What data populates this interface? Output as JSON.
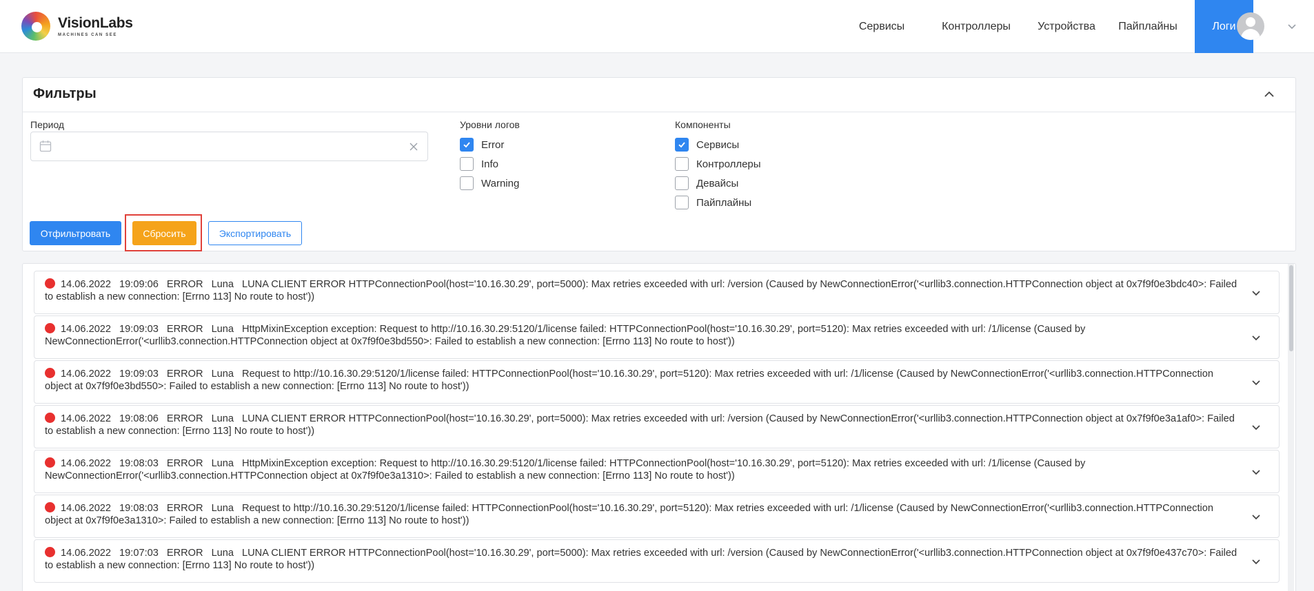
{
  "brand": {
    "name": "VisionLabs",
    "tagline": "MACHINES CAN SEE"
  },
  "nav": [
    {
      "label": "Сервисы",
      "active": false
    },
    {
      "label": "Контроллеры",
      "active": false
    },
    {
      "label": "Устройства",
      "active": false
    },
    {
      "label": "Пайплайны",
      "active": false
    },
    {
      "label": "Логи",
      "active": true
    }
  ],
  "filters": {
    "title": "Фильтры",
    "period_label": "Период",
    "period_value": "",
    "levels_label": "Уровни логов",
    "levels": [
      {
        "label": "Error",
        "checked": true
      },
      {
        "label": "Info",
        "checked": false
      },
      {
        "label": "Warning",
        "checked": false
      }
    ],
    "components_label": "Компоненты",
    "components": [
      {
        "label": "Сервисы",
        "checked": true
      },
      {
        "label": "Контроллеры",
        "checked": false
      },
      {
        "label": "Девайсы",
        "checked": false
      },
      {
        "label": "Пайплайны",
        "checked": false
      }
    ],
    "filter_button": "Отфильтровать",
    "reset_button": "Сбросить",
    "export_button": "Экспортировать"
  },
  "logs": [
    {
      "date": "14.06.2022",
      "time": "19:09:06",
      "level": "ERROR",
      "source": "Luna",
      "message": "LUNA CLIENT ERROR HTTPConnectionPool(host='10.16.30.29', port=5000): Max retries exceeded with url: /version (Caused by NewConnectionError('<urllib3.connection.HTTPConnection object at 0x7f9f0e3bdc40>: Failed to establish a new connection: [Errno 113] No route to host'))"
    },
    {
      "date": "14.06.2022",
      "time": "19:09:03",
      "level": "ERROR",
      "source": "Luna",
      "message": "HttpMixinException exception: Request to http://10.16.30.29:5120/1/license failed: HTTPConnectionPool(host='10.16.30.29', port=5120): Max retries exceeded with url: /1/license (Caused by NewConnectionError('<urllib3.connection.HTTPConnection object at 0x7f9f0e3bd550>: Failed to establish a new connection: [Errno 113] No route to host'))"
    },
    {
      "date": "14.06.2022",
      "time": "19:09:03",
      "level": "ERROR",
      "source": "Luna",
      "message": "Request to http://10.16.30.29:5120/1/license failed: HTTPConnectionPool(host='10.16.30.29', port=5120): Max retries exceeded with url: /1/license (Caused by NewConnectionError('<urllib3.connection.HTTPConnection object at 0x7f9f0e3bd550>: Failed to establish a new connection: [Errno 113] No route to host'))"
    },
    {
      "date": "14.06.2022",
      "time": "19:08:06",
      "level": "ERROR",
      "source": "Luna",
      "message": "LUNA CLIENT ERROR HTTPConnectionPool(host='10.16.30.29', port=5000): Max retries exceeded with url: /version (Caused by NewConnectionError('<urllib3.connection.HTTPConnection object at 0x7f9f0e3a1af0>: Failed to establish a new connection: [Errno 113] No route to host'))"
    },
    {
      "date": "14.06.2022",
      "time": "19:08:03",
      "level": "ERROR",
      "source": "Luna",
      "message": "HttpMixinException exception: Request to http://10.16.30.29:5120/1/license failed: HTTPConnectionPool(host='10.16.30.29', port=5120): Max retries exceeded with url: /1/license (Caused by NewConnectionError('<urllib3.connection.HTTPConnection object at 0x7f9f0e3a1310>: Failed to establish a new connection: [Errno 113] No route to host'))"
    },
    {
      "date": "14.06.2022",
      "time": "19:08:03",
      "level": "ERROR",
      "source": "Luna",
      "message": "Request to http://10.16.30.29:5120/1/license failed: HTTPConnectionPool(host='10.16.30.29', port=5120): Max retries exceeded with url: /1/license (Caused by NewConnectionError('<urllib3.connection.HTTPConnection object at 0x7f9f0e3a1310>: Failed to establish a new connection: [Errno 113] No route to host'))"
    },
    {
      "date": "14.06.2022",
      "time": "19:07:03",
      "level": "ERROR",
      "source": "Luna",
      "message": "LUNA CLIENT ERROR HTTPConnectionPool(host='10.16.30.29', port=5000): Max retries exceeded with url: /version (Caused by NewConnectionError('<urllib3.connection.HTTPConnection object at 0x7f9f0e437c70>: Failed to establish a new connection: [Errno 113] No route to host'))"
    }
  ],
  "colors": {
    "accent": "#2f86f0",
    "reset": "#f5a31a",
    "error_dot": "#e8302f",
    "highlight": "#e0413a"
  }
}
